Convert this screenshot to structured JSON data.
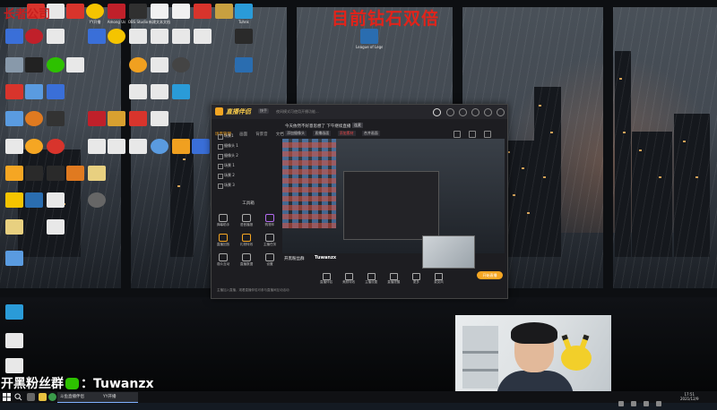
{
  "overlay": {
    "headline": "目前钻石双倍",
    "top_left": "长者公司"
  },
  "desktop": {
    "icons": [
      {
        "label": "",
        "color": "#3a6fd8"
      },
      {
        "label": "",
        "color": "#d8342c"
      },
      {
        "label": "",
        "color": "#e8e8e8"
      },
      {
        "label": "",
        "color": "#d8342c"
      },
      {
        "label": "YY开播",
        "color": "#f5c400"
      },
      {
        "label": "Among Us",
        "color": "#c0202a"
      },
      {
        "label": "OBS Studio",
        "color": "#303030"
      },
      {
        "label": "新建文本文档",
        "color": "#f1f1f1"
      },
      {
        "label": "原神",
        "color": "#f1f1f1"
      },
      {
        "label": "英雄联盟",
        "color": "#c8a040"
      },
      {
        "label": "Tuhnk",
        "color": "#2a9bd8"
      },
      {
        "label": "League of Legends",
        "color": "#2a6db0"
      }
    ]
  },
  "app": {
    "name": "直播伴侣",
    "user": "快手",
    "notice": "夜间模式可使用开播功能...",
    "tabs": [
      "场景管理",
      "画面",
      "背景音",
      "文档"
    ],
    "scenes": [
      "场景1",
      "摄像头 1",
      "摄像头 2",
      "场景 1",
      "场景 2",
      "场景 3"
    ],
    "toolbox_title": "工具箱",
    "tools": [
      "弹幕助手",
      "语音播报",
      "购物车",
      "直播回放",
      "礼物特效",
      "主播任务",
      "观众互动",
      "直播数据",
      "设置"
    ],
    "preview_title": "今天依然不好意思想了 下午继续直播",
    "preview_tag": "连麦",
    "controls": [
      "添加摄像头",
      "直播画面",
      "添加素材",
      "合并画面"
    ],
    "streamer_title": "开黑粉丝群",
    "streamer_name": "Tuwanzx",
    "bottom_tools": [
      "直播伴侣",
      "美颜特效",
      "主播设置",
      "直播提醒",
      "更多",
      "麦克风"
    ],
    "start_label": "开始直播",
    "bottom_note": "主播加入直播，观看直播伴侣可参与直播间互动活动"
  },
  "caption": {
    "text": "开黑粉丝群",
    "colon": "：",
    "wechat_id": "Tuwanzx"
  },
  "taskbar": {
    "windows": [
      "斗鱼直播伴侣",
      "YY开播"
    ],
    "clock_time": "17:51",
    "clock_date": "2021/12/9"
  }
}
